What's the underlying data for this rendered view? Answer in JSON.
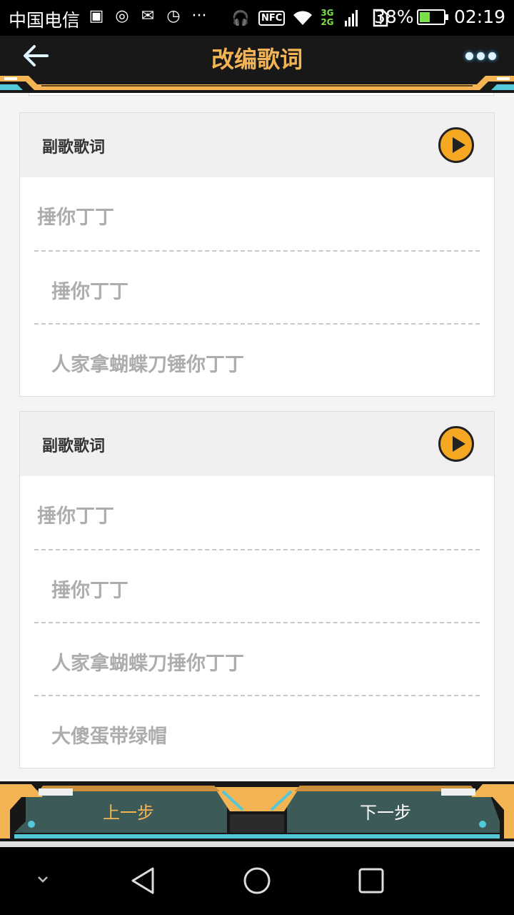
{
  "status": {
    "carrier": "中国电信",
    "battery": "38%",
    "battery_level": 0.38,
    "time": "02:19",
    "net_top": "3G",
    "net_bottom": "2G",
    "nfc": "NFC",
    "more_dots": "···"
  },
  "header": {
    "title": "改编歌词",
    "back_icon": "back-arrow-icon",
    "more_icon": "more-dots-icon"
  },
  "sections": [
    {
      "label": "副歌歌词",
      "lines": [
        "捶你丁丁",
        "捶你丁丁",
        "人家拿蝴蝶刀锤你丁丁"
      ]
    },
    {
      "label": "副歌歌词",
      "lines": [
        "捶你丁丁",
        "捶你丁丁",
        "人家拿蝴蝶刀捶你丁丁",
        "大傻蛋带绿帽"
      ]
    }
  ],
  "footer": {
    "prev_label": "上一步",
    "next_label": "下一步"
  },
  "colors": {
    "accent": "#f5b454",
    "play": "#f7a823",
    "line_text": "#adadad",
    "header_bg": "#181818"
  }
}
